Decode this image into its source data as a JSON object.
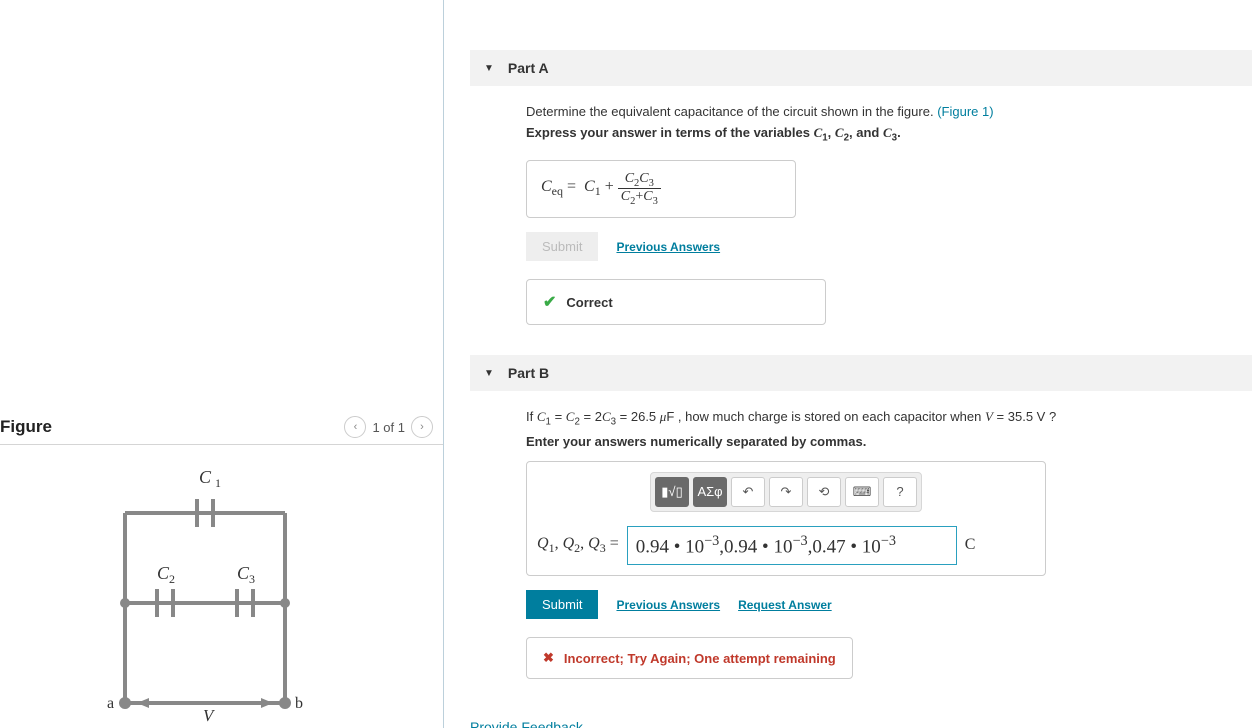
{
  "figure": {
    "title": "Figure",
    "pager": "1 of 1",
    "labels": {
      "c1": "C₁",
      "c2": "C₂",
      "c3": "C₃",
      "a": "a",
      "b": "b",
      "v": "V"
    }
  },
  "partA": {
    "title": "Part A",
    "prompt_prefix": "Determine the equivalent capacitance of the circuit shown in the figure.",
    "figlink": "(Figure 1)",
    "instruction": "Express your answer in terms of the variables C₁, C₂, and C₃.",
    "answer_lhs": "Cₑq =",
    "answer_rhs_main": "C₁ +",
    "answer_frac_num": "C₂C₃",
    "answer_frac_den": "C₂+C₃",
    "submit_label": "Submit",
    "prev_label": "Previous Answers",
    "feedback": "Correct"
  },
  "partB": {
    "title": "Part B",
    "prompt": "If C₁ = C₂ = 2C₃ = 26.5 μF , how much charge is stored on each capacitor when V = 35.5 V ?",
    "instruction": "Enter your answers numerically separated by commas.",
    "lhs": "Q₁, Q₂, Q₃ =",
    "input_value": "0.94 • 10⁻³,0.94 • 10⁻³,0.47 • 10⁻³",
    "unit": "C",
    "submit_label": "Submit",
    "prev_label": "Previous Answers",
    "req_label": "Request Answer",
    "feedback": "Incorrect; Try Again; One attempt remaining",
    "toolbar": {
      "templates": "▮√▯",
      "greek": "ΑΣφ",
      "undo": "↶",
      "redo": "↷",
      "reset": "⟲",
      "keyboard": "⌨",
      "help": "?"
    }
  },
  "provide_feedback": "Provide Feedback"
}
